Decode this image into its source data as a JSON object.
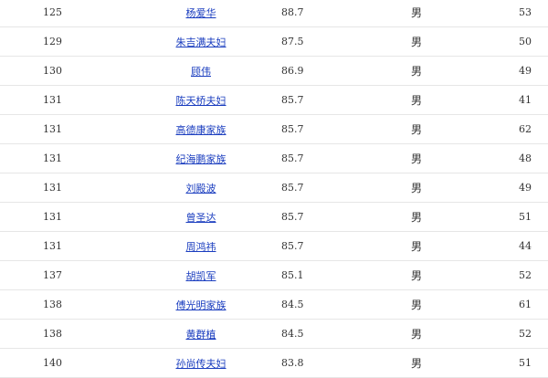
{
  "rows": [
    {
      "rank": "125",
      "name": "杨爱华",
      "wealth": "88.7",
      "gender": "男",
      "age": "53"
    },
    {
      "rank": "129",
      "name": "朱吉满夫妇",
      "wealth": "87.5",
      "gender": "男",
      "age": "50"
    },
    {
      "rank": "130",
      "name": "顾伟",
      "wealth": "86.9",
      "gender": "男",
      "age": "49"
    },
    {
      "rank": "131",
      "name": "陈天桥夫妇",
      "wealth": "85.7",
      "gender": "男",
      "age": "41"
    },
    {
      "rank": "131",
      "name": "高德康家族",
      "wealth": "85.7",
      "gender": "男",
      "age": "62"
    },
    {
      "rank": "131",
      "name": "纪海鹏家族",
      "wealth": "85.7",
      "gender": "男",
      "age": "48"
    },
    {
      "rank": "131",
      "name": "刘殿波",
      "wealth": "85.7",
      "gender": "男",
      "age": "49"
    },
    {
      "rank": "131",
      "name": "曾圣达",
      "wealth": "85.7",
      "gender": "男",
      "age": "51"
    },
    {
      "rank": "131",
      "name": "周鸿祎",
      "wealth": "85.7",
      "gender": "男",
      "age": "44"
    },
    {
      "rank": "137",
      "name": "胡凯军",
      "wealth": "85.1",
      "gender": "男",
      "age": "52"
    },
    {
      "rank": "138",
      "name": "傅光明家族",
      "wealth": "84.5",
      "gender": "男",
      "age": "61"
    },
    {
      "rank": "138",
      "name": "黄群植",
      "wealth": "84.5",
      "gender": "男",
      "age": "52"
    },
    {
      "rank": "140",
      "name": "孙尚传夫妇",
      "wealth": "83.8",
      "gender": "男",
      "age": "51"
    }
  ]
}
